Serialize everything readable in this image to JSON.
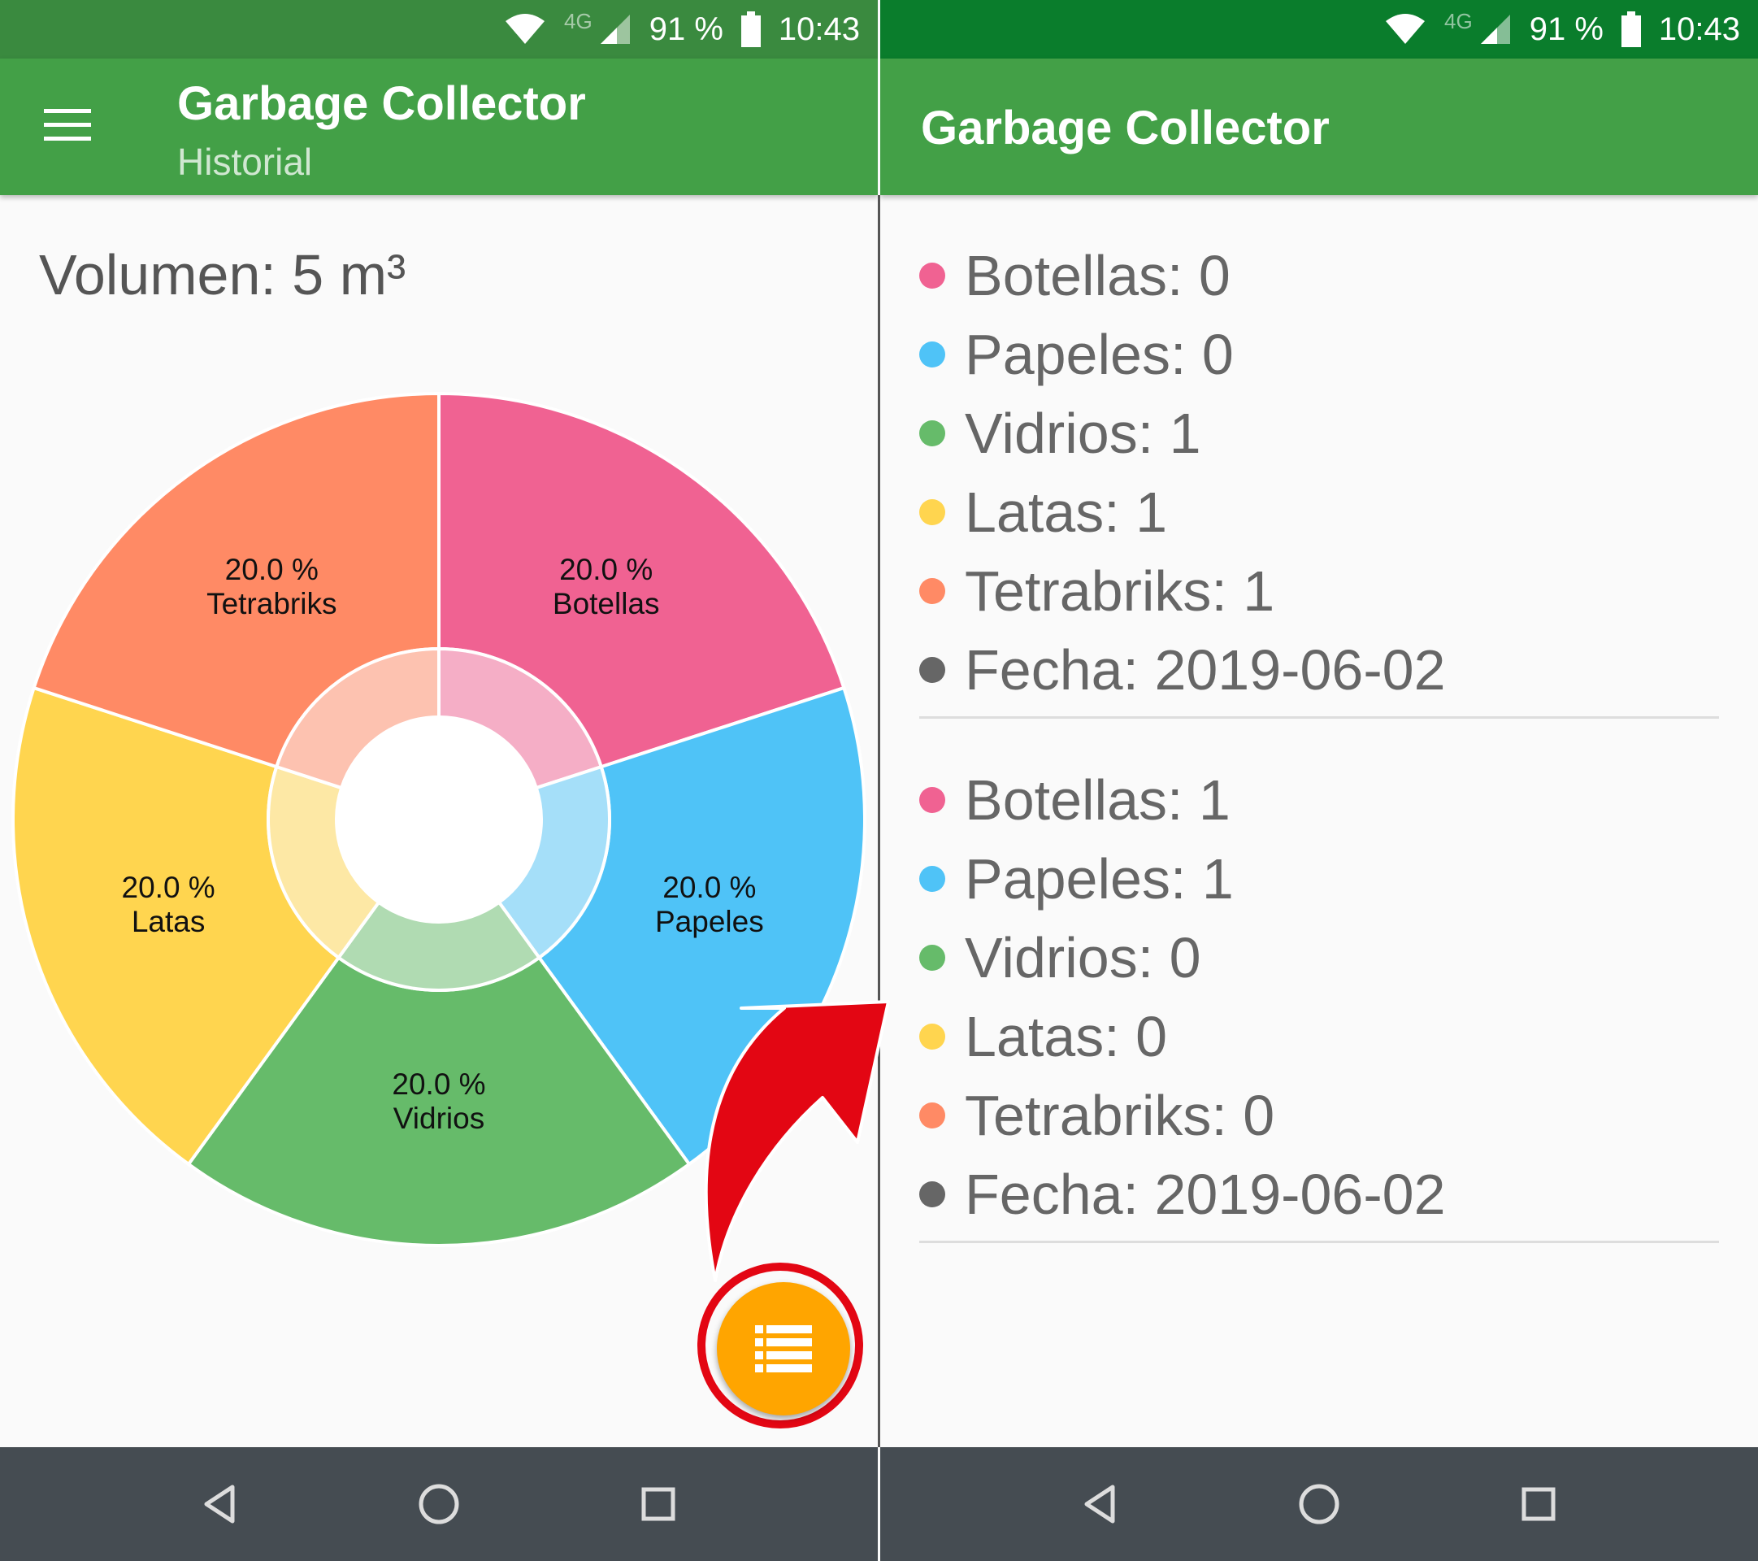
{
  "status_bar": {
    "network": "4G",
    "battery": "91 %",
    "time": "10:43"
  },
  "left_screen": {
    "app_title": "Garbage Collector",
    "subtitle": "Historial",
    "volume": "Volumen: 5 m³"
  },
  "chart_data": {
    "type": "pie",
    "categories": [
      "Botellas",
      "Papeles",
      "Vidrios",
      "Latas",
      "Tetrabriks"
    ],
    "values": [
      20.0,
      20.0,
      20.0,
      20.0,
      20.0
    ],
    "labels": [
      "20.0 %",
      "20.0 %",
      "20.0 %",
      "20.0 %",
      "20.0 %"
    ],
    "colors": [
      "#f06292",
      "#4fc3f7",
      "#66bb6a",
      "#ffd54f",
      "#ff8a65"
    ],
    "style": "donut"
  },
  "right_screen": {
    "app_title": "Garbage Collector",
    "records": [
      {
        "rows": [
          {
            "text": "Botellas: 0",
            "color": "#f06292"
          },
          {
            "text": "Papeles: 0",
            "color": "#4fc3f7"
          },
          {
            "text": "Vidrios: 1",
            "color": "#66bb6a"
          },
          {
            "text": "Latas: 1",
            "color": "#ffd54f"
          },
          {
            "text": "Tetrabriks: 1",
            "color": "#ff8a65"
          },
          {
            "text": "Fecha: 2019-06-02",
            "color": "#666666"
          }
        ]
      },
      {
        "rows": [
          {
            "text": "Botellas: 1",
            "color": "#f06292"
          },
          {
            "text": "Papeles: 1",
            "color": "#4fc3f7"
          },
          {
            "text": "Vidrios: 0",
            "color": "#66bb6a"
          },
          {
            "text": "Latas: 0",
            "color": "#ffd54f"
          },
          {
            "text": "Tetrabriks: 0",
            "color": "#ff8a65"
          },
          {
            "text": "Fecha: 2019-06-02",
            "color": "#666666"
          }
        ]
      }
    ]
  },
  "icons": {
    "menu": "hamburger-icon",
    "fab": "list-icon",
    "annotation": "red-arrow",
    "nav": [
      "back-icon",
      "home-icon",
      "recents-icon"
    ]
  },
  "colors": {
    "appbar": "#43a047",
    "fab": "#ffa500",
    "annotation": "#e30613"
  }
}
